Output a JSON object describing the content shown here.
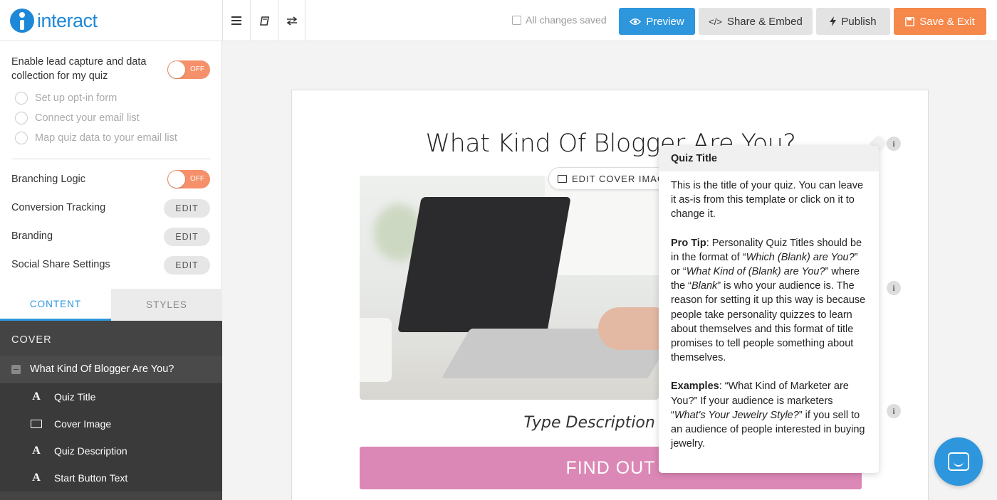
{
  "brand": {
    "name": "interact",
    "color": "#1e88d8"
  },
  "toolbar": {
    "icons": [
      "menu-icon",
      "book-icon",
      "swap-icon"
    ],
    "status": "All changes saved",
    "preview": "Preview",
    "share": "Share & Embed",
    "publish": "Publish",
    "save_exit": "Save & Exit"
  },
  "sidebar": {
    "lead_capture": {
      "label": "Enable lead capture and data collection for my quiz",
      "toggle": "OFF",
      "options": [
        "Set up opt-in form",
        "Connect your email list",
        "Map quiz data to your email list"
      ]
    },
    "branching": {
      "label": "Branching Logic",
      "toggle": "OFF"
    },
    "settings": [
      {
        "label": "Conversion Tracking",
        "action": "EDIT"
      },
      {
        "label": "Branding",
        "action": "EDIT"
      },
      {
        "label": "Social Share Settings",
        "action": "EDIT"
      }
    ],
    "tabs": [
      "CONTENT",
      "STYLES"
    ],
    "tree": {
      "section": "COVER",
      "parent": "What Kind Of Blogger Are You?",
      "children": [
        "Quiz Title",
        "Cover Image",
        "Quiz Description",
        "Start Button Text"
      ]
    }
  },
  "canvas": {
    "title": "What Kind Of Blogger Are You?",
    "edit_cover": "EDIT COVER IMAGE",
    "description": "Type Description Here",
    "start_button": "FIND OUT",
    "button_color": "#dc88b6"
  },
  "tooltip": {
    "title": "Quiz Title",
    "intro": "This is the title of your quiz. You can leave it as-is from this template or click on it to change it.",
    "pro_tip_label": "Pro Tip",
    "pro_tip_a": ": Personality Quiz Titles should be in the format of “",
    "pro_tip_ex1": "Which (Blank) are You?",
    "pro_tip_b": "” or “",
    "pro_tip_ex2": "What Kind of (Blank) are You?",
    "pro_tip_c": "” where the “",
    "pro_tip_blank": "Blank",
    "pro_tip_d": "” is who your audience is. The reason for setting it up this way is because people take personality quizzes to learn about themselves and this format of title promises to tell people something about themselves.",
    "examples_label": "Examples",
    "examples_a": ": “What Kind of Marketer are You?” If your audience is marketers “",
    "examples_ex": "What's Your Jewelry Style?",
    "examples_b": "” if you sell to an audience of people interested in buying jewelry."
  },
  "colors": {
    "accent": "#2d96dc",
    "save": "#f5884a",
    "toggle_off": "#f5906a"
  }
}
